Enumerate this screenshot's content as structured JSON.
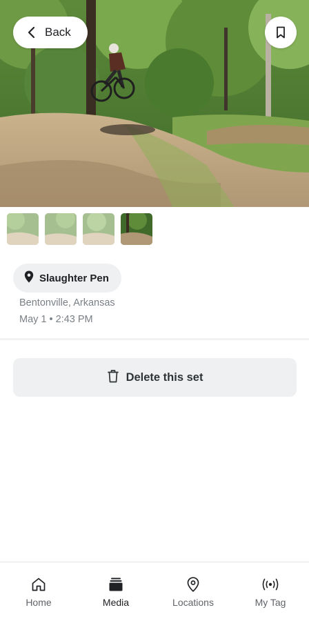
{
  "header": {
    "back_label": "Back",
    "back_icon": "chevron-left-icon",
    "bookmark_icon": "bookmark-icon"
  },
  "thumbnails": [
    {
      "name": "thumbnail-1",
      "selected": false
    },
    {
      "name": "thumbnail-2",
      "selected": false
    },
    {
      "name": "thumbnail-3",
      "selected": false
    },
    {
      "name": "thumbnail-4",
      "selected": true
    }
  ],
  "location": {
    "name": "Slaughter Pen",
    "icon": "map-pin-icon",
    "city": "Bentonville, Arkansas",
    "datetime": "May 1 • 2:43 PM"
  },
  "actions": {
    "delete_label": "Delete this set",
    "delete_icon": "trash-icon"
  },
  "nav": {
    "items": [
      {
        "label": "Home",
        "icon": "home-icon",
        "active": false
      },
      {
        "label": "Media",
        "icon": "media-stack-icon",
        "active": true
      },
      {
        "label": "Locations",
        "icon": "location-pin-icon",
        "active": false
      },
      {
        "label": "My Tag",
        "icon": "broadcast-icon",
        "active": false
      }
    ]
  },
  "colors": {
    "chip_bg": "#eef0f1",
    "text_primary": "#202124",
    "text_secondary": "#7a7f85"
  }
}
